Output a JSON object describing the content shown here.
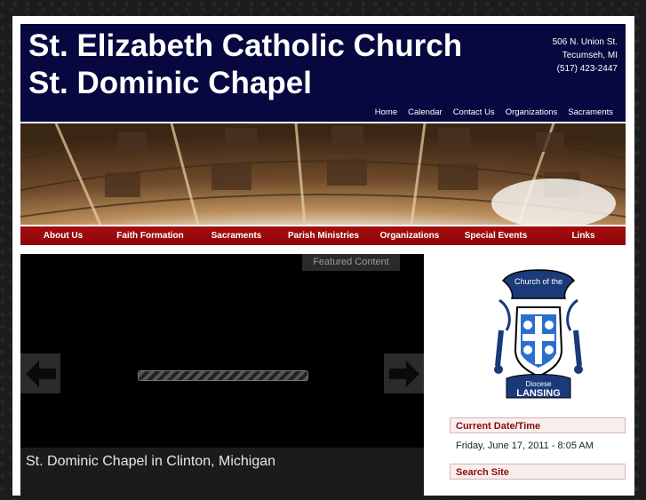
{
  "header": {
    "title_line1": "St. Elizabeth Catholic Church",
    "title_line2": "St. Dominic Chapel",
    "address": [
      "506 N. Union St.",
      "Tecumseh, MI",
      "(517) 423-2447"
    ],
    "top_nav": [
      "Home",
      "Calendar",
      "Contact Us",
      "Organizations",
      "Sacraments"
    ]
  },
  "main_nav": [
    "About Us",
    "Faith Formation",
    "Sacraments",
    "Parish Ministries",
    "Organizations",
    "Special Events",
    "Links"
  ],
  "slider": {
    "featured_label": "Featured Content",
    "caption": "St. Dominic Chapel in Clinton, Michigan"
  },
  "sidebar": {
    "crest_text_top": "Church of the",
    "crest_text_bottom": [
      "Diocese",
      "LANSING"
    ],
    "current_date_title": "Current Date/Time",
    "current_date": "Friday, June 17, 2011 - 8:05 AM",
    "search_title": "Search Site"
  },
  "colors": {
    "header_bg": "#06083f",
    "nav_red": "#a80d10",
    "widget_title": "#8a0b0b"
  }
}
